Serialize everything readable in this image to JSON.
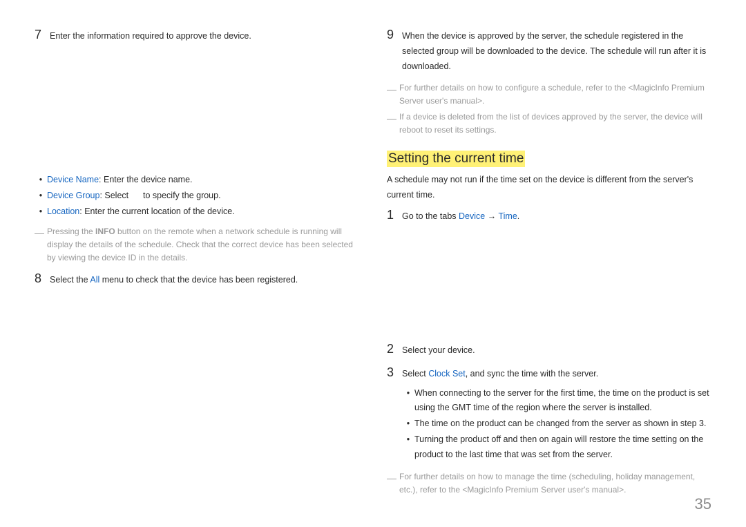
{
  "left": {
    "step7": {
      "num": "7",
      "text": "Enter the information required to approve the device."
    },
    "bullets": {
      "b1": {
        "label": "Device Name",
        "text": ": Enter the device name."
      },
      "b2": {
        "label": "Device Group",
        "text_a": ": Select ",
        "text_b": " to specify the group."
      },
      "b3": {
        "label": "Location",
        "text": ": Enter the current location of the device."
      }
    },
    "note1": {
      "pre": "Pressing the ",
      "info": "INFO",
      "post": " button on the remote when a network schedule is running will display the details of the schedule. Check that the correct device has been selected by viewing the device ID in the details."
    },
    "step8": {
      "num": "8",
      "text_a": "Select the ",
      "all": "All",
      "text_b": " menu to check that the device has been registered."
    }
  },
  "right": {
    "step9": {
      "num": "9",
      "text": "When the device is approved by the server, the schedule registered in the selected group will be downloaded to the device. The schedule will run after it is downloaded."
    },
    "note_a": "For further details on how to configure a schedule, refer to the <MagicInfo Premium Server user's manual>.",
    "note_b": "If a device is deleted from the list of devices approved by the server, the device will reboot to reset its settings.",
    "heading": "Setting the current time",
    "para": "A schedule may not run if the time set on the device is different from the server's current time.",
    "step1": {
      "num": "1",
      "text_a": "Go to the tabs ",
      "device": "Device",
      "arrow": " → ",
      "time": "Time",
      "text_b": "."
    },
    "step2": {
      "num": "2",
      "text": "Select your device."
    },
    "step3": {
      "num": "3",
      "text_a": "Select ",
      "clock": "Clock Set",
      "text_b": ", and sync the time with the server."
    },
    "sub": {
      "s1": "When connecting to the server for the first time, the time on the product is set using the GMT time of the region where the server is installed.",
      "s2": "The time on the product can be changed from the server as shown in step 3.",
      "s3": "Turning the product off and then on again will restore the time setting on the product to the last time that was set from the server."
    },
    "note_c": "For further details on how to manage the time (scheduling, holiday management, etc.), refer to the <MagicInfo Premium Server user's manual>."
  },
  "page_number": "35"
}
